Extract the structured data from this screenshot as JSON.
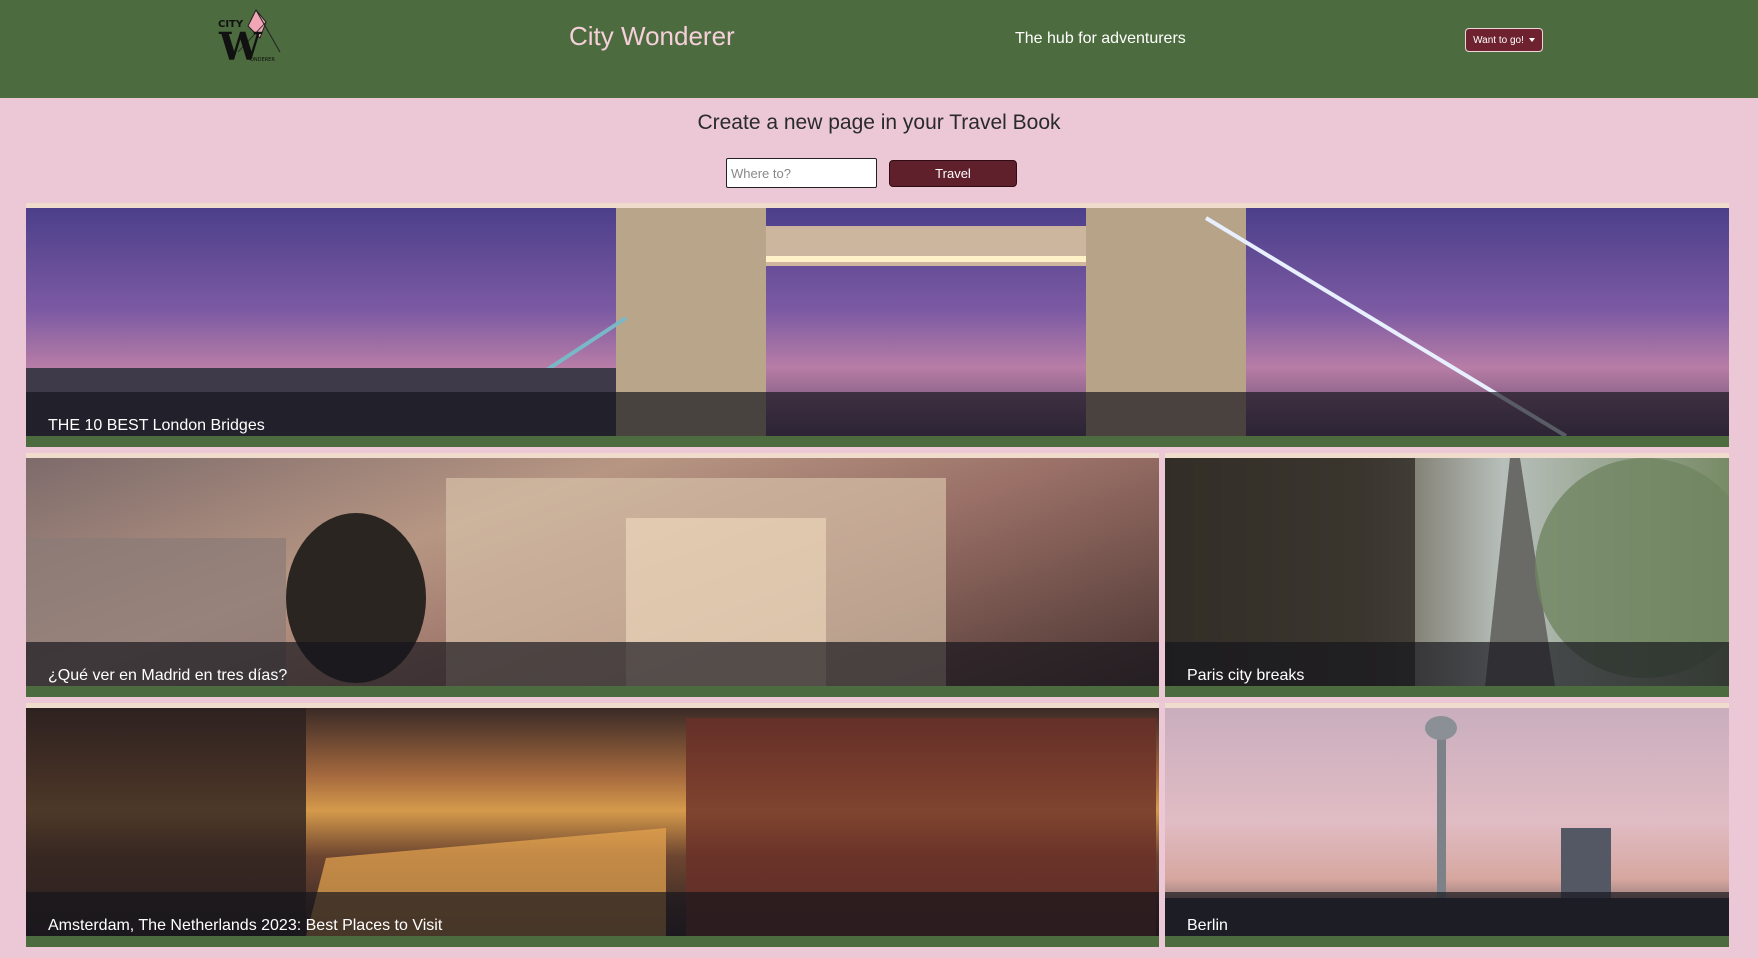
{
  "header": {
    "logo_alt": "City Wonderer logo",
    "title": "City Wonderer",
    "tagline": "The hub for adventurers",
    "dropdown_label": "Want to go!"
  },
  "main": {
    "heading": "Create a new page in your Travel Book",
    "search_placeholder": "Where to?",
    "search_value": "",
    "travel_button": "Travel"
  },
  "cards": [
    {
      "id": "london",
      "caption": "THE 10 BEST London Bridges"
    },
    {
      "id": "madrid",
      "caption": "¿Qué ver en Madrid en tres días?"
    },
    {
      "id": "paris",
      "caption": "Paris city breaks"
    },
    {
      "id": "amsterdam",
      "caption": "Amsterdam, The Netherlands 2023: Best Places to Visit"
    },
    {
      "id": "berlin",
      "caption": "Berlin"
    }
  ],
  "colors": {
    "header_green": "#4c6b3e",
    "page_pink": "#ecc8d6",
    "button_maroon": "#5f1f2b",
    "title_pink": "#f5cfd9"
  },
  "icons": {
    "dropdown": "caret-down-icon",
    "logo": "city-wonderer-logo"
  }
}
